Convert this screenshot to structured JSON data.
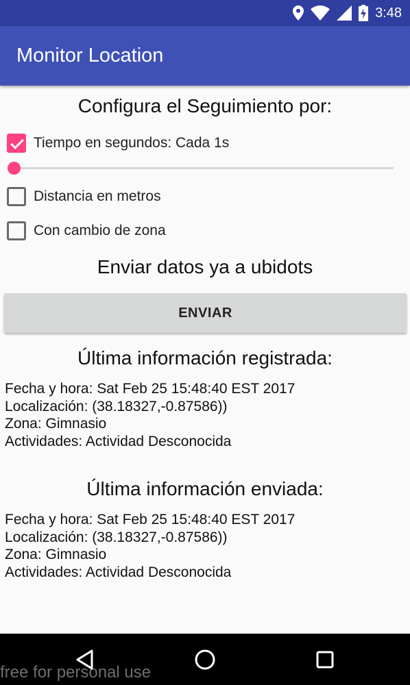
{
  "status_bar": {
    "time": "3:48",
    "icons": [
      "location-icon",
      "wifi-icon",
      "signal-icon",
      "battery-charging-icon"
    ]
  },
  "app_bar": {
    "title": "Monitor Location",
    "color": "#3f51b5"
  },
  "tracking": {
    "heading": "Configura el Seguimiento por:",
    "time_option": {
      "label": "Tiempo en segundos: Cada 1s",
      "checked": true
    },
    "time_slider": {
      "value": 0.0
    },
    "distance_option": {
      "label": "Distancia en metros",
      "checked": false
    },
    "zone_option": {
      "label": "Con cambio de zona",
      "checked": false
    }
  },
  "send": {
    "heading": "Enviar datos ya a ubidots",
    "button_label": "ENVIAR"
  },
  "last_recorded": {
    "heading": "Última información registrada:",
    "date_line": "Fecha y hora: Sat Feb 25 15:48:40 EST 2017",
    "location_line": "Localización: (38.18327,-0.87586))",
    "zone_line": "Zona: Gimnasio",
    "activities_line": "Actividades: Actividad Desconocida"
  },
  "last_sent": {
    "heading": "Última información enviada:",
    "date_line": "Fecha y hora: Sat Feb 25 15:48:40 EST 2017",
    "location_line": "Localización: (38.18327,-0.87586))",
    "zone_line": "Zona: Gimnasio",
    "activities_line": "Actividades: Actividad Desconocida"
  },
  "nav_bar": {
    "icons": [
      "back-icon",
      "home-icon",
      "recents-icon"
    ]
  },
  "watermark": "free for personal use",
  "colors": {
    "accent": "#ff4081",
    "primary_dark": "#303f9f"
  }
}
